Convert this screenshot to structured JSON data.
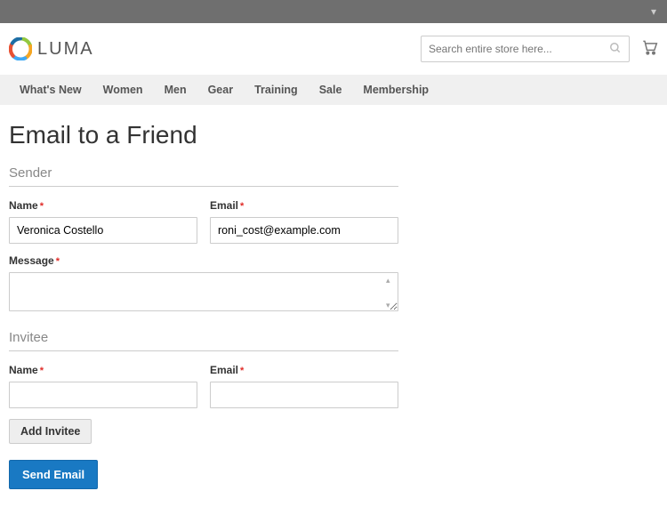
{
  "topbar": {
    "chevron_icon": "▾"
  },
  "header": {
    "logo_text": "LUMA",
    "search_placeholder": "Search entire store here...",
    "cart_glyph": "🛒"
  },
  "nav": {
    "items": [
      {
        "label": "What's New"
      },
      {
        "label": "Women"
      },
      {
        "label": "Men"
      },
      {
        "label": "Gear"
      },
      {
        "label": "Training"
      },
      {
        "label": "Sale"
      },
      {
        "label": "Membership"
      }
    ]
  },
  "page_title": "Email to a Friend",
  "sender": {
    "legend": "Sender",
    "name_label": "Name",
    "name_value": "Veronica Costello",
    "email_label": "Email",
    "email_value": "roni_cost@example.com",
    "message_label": "Message",
    "message_value": ""
  },
  "invitee": {
    "legend": "Invitee",
    "name_label": "Name",
    "name_value": "",
    "email_label": "Email",
    "email_value": ""
  },
  "buttons": {
    "add_invitee": "Add Invitee",
    "send_email": "Send Email"
  },
  "required_mark": "*"
}
